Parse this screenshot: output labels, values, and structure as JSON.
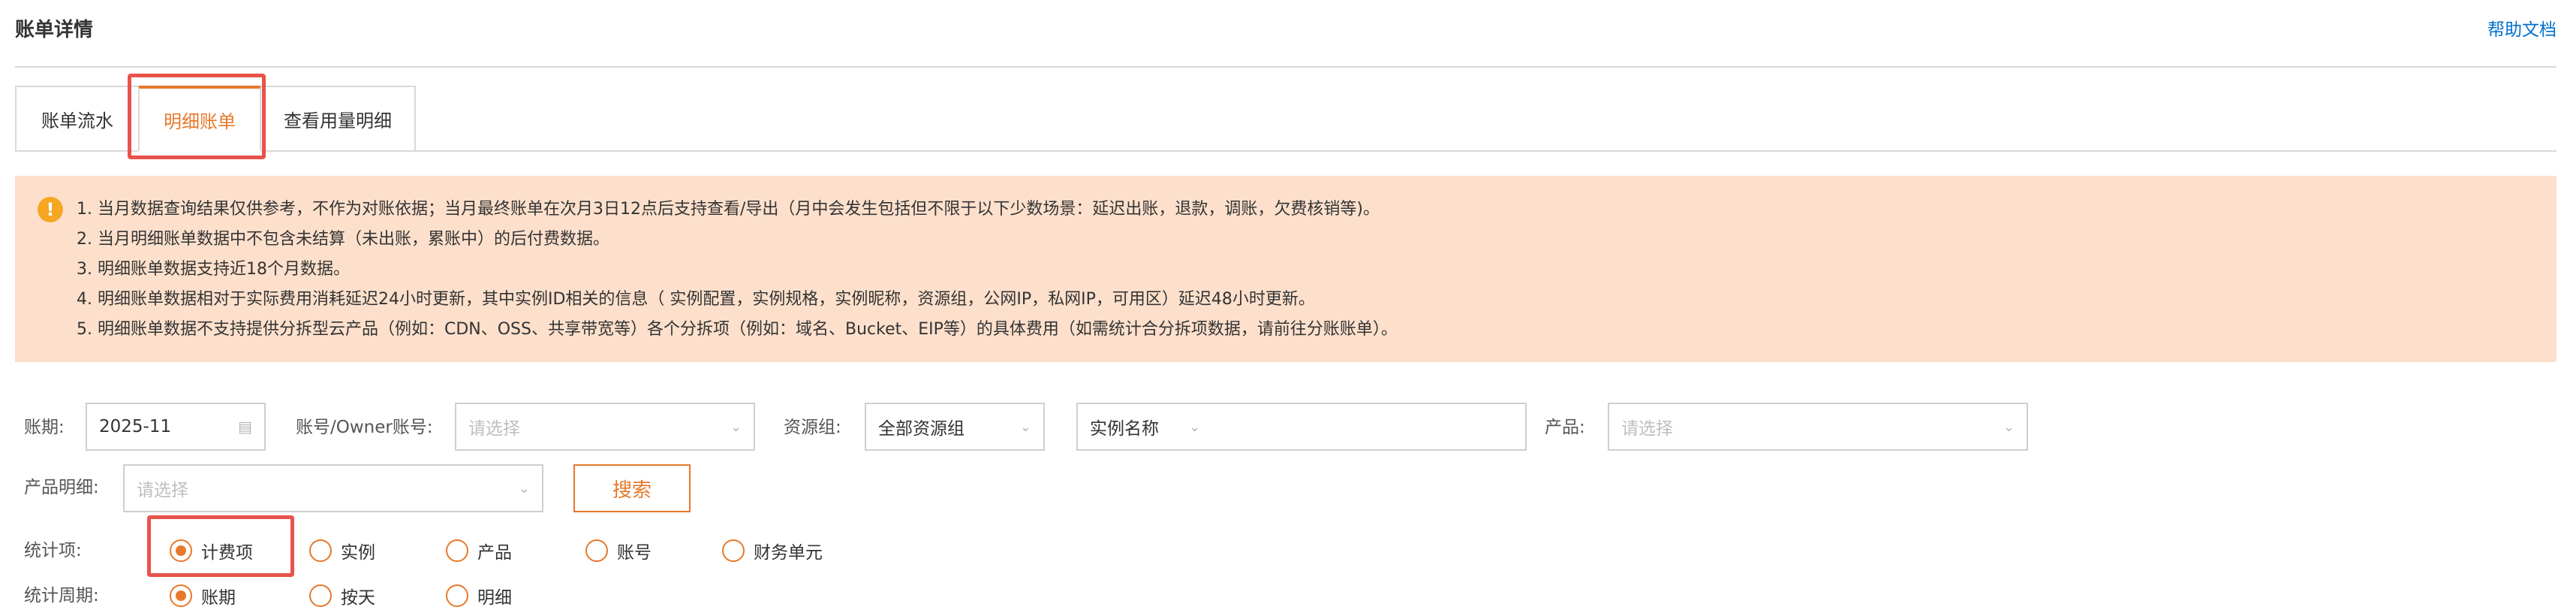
{
  "header": {
    "title": "账单详情",
    "help_link": "帮助文档"
  },
  "tabs": [
    {
      "label": "账单流水",
      "active": false
    },
    {
      "label": "明细账单",
      "active": true
    },
    {
      "label": "查看用量明细",
      "active": false
    }
  ],
  "notice": {
    "icon": "info-icon",
    "lines": [
      "1. 当月数据查询结果仅供参考，不作为对账依据；当月最终账单在次月3日12点后支持查看/导出（月中会发生包括但不限于以下少数场景：延迟出账，退款，调账，欠费核销等)。",
      "2. 当月明细账单数据中不包含未结算（未出账，累账中）的后付费数据。",
      "3. 明细账单数据支持近18个月数据。",
      "4. 明细账单数据相对于实际费用消耗延迟24小时更新，其中实例ID相关的信息（ 实例配置，实例规格，实例昵称，资源组，公网IP，私网IP，可用区）延迟48小时更新。",
      "5. 明细账单数据不支持提供分拆型云产品（例如：CDN、OSS、共享带宽等）各个分拆项（例如：域名、Bucket、EIP等）的具体费用（如需统计合分拆项数据，请前往分账账单）。"
    ]
  },
  "filters": {
    "period": {
      "label": "账期:",
      "value": "2025-11",
      "icon": "calendar-icon"
    },
    "account": {
      "label": "账号/Owner账号:",
      "placeholder": "请选择"
    },
    "resource_group": {
      "label": "资源组:",
      "value": "全部资源组"
    },
    "instance": {
      "value": "实例名称"
    },
    "product": {
      "label": "产品:",
      "placeholder": "请选择"
    },
    "product_detail": {
      "label": "产品明细:",
      "placeholder": "请选择"
    },
    "search_label": "搜索"
  },
  "stat_item": {
    "label": "统计项:",
    "selected": "计费项",
    "options": [
      "计费项",
      "实例",
      "产品",
      "账号",
      "财务单元"
    ]
  },
  "stat_period": {
    "label": "统计周期:",
    "selected": "账期",
    "options": [
      "账期",
      "按天",
      "明细"
    ]
  },
  "colors": {
    "accent": "#e6792b",
    "notice_bg": "#fde0cc",
    "highlight": "#e8534b",
    "link": "#0070cc"
  }
}
